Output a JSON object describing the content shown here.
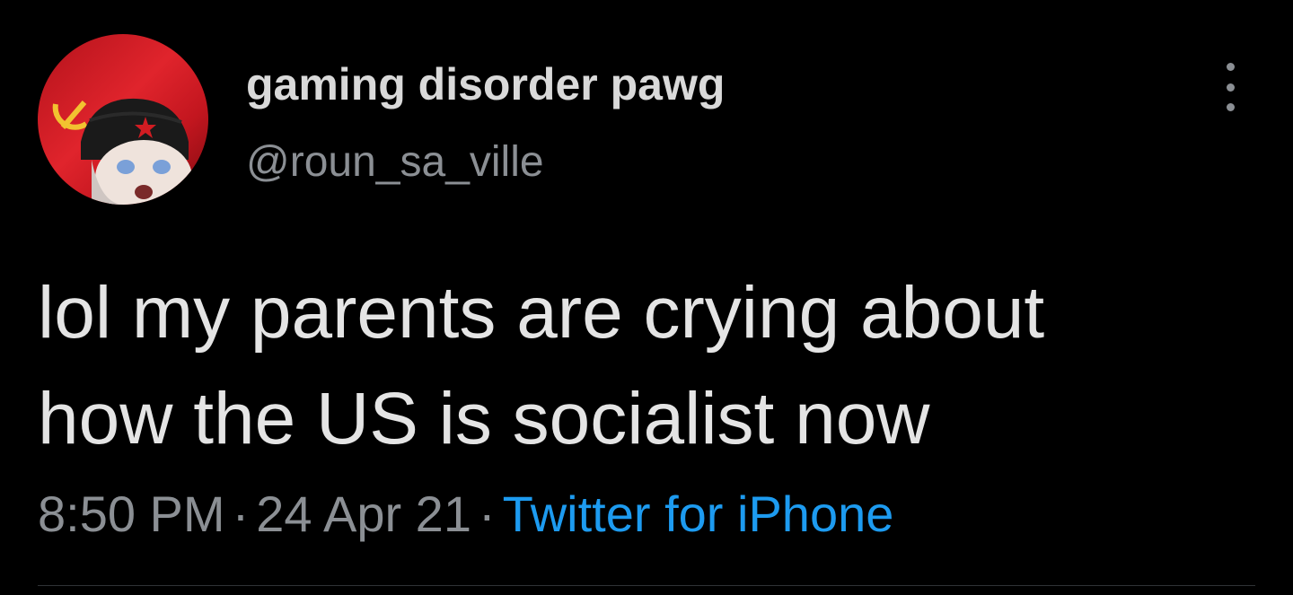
{
  "tweet": {
    "author": {
      "display_name": "gaming disorder pawg",
      "handle": "@roun_sa_ville",
      "avatar": "avatar-image"
    },
    "more_options_icon": "vertical-ellipsis-icon",
    "text_lines": [
      "lol my parents are crying about",
      "how the US is socialist now"
    ],
    "meta": {
      "time": "8:50 PM",
      "separator": "·",
      "date": "24 Apr 21",
      "source": "Twitter for iPhone"
    }
  },
  "colors": {
    "background": "#000000",
    "primary_text": "#d9d9d9",
    "secondary_text": "#8b8f94",
    "link": "#1d9bf0",
    "divider": "#2f3336"
  }
}
